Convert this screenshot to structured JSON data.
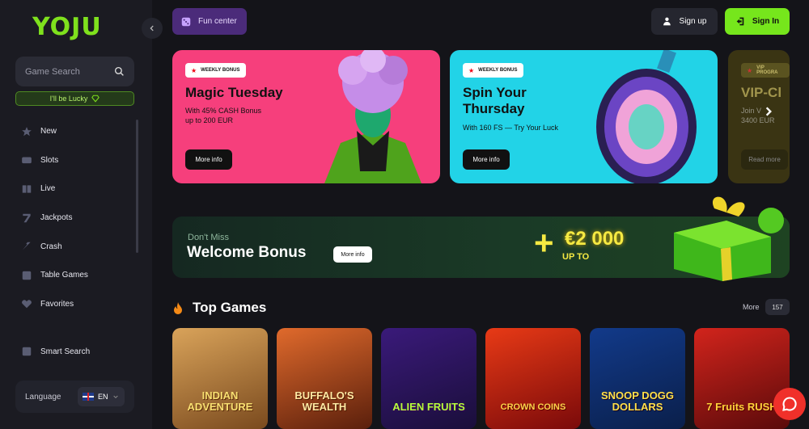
{
  "logo": {
    "text": "YOJU"
  },
  "sidebar": {
    "search_placeholder": "Game Search",
    "lucky_label": "I'll be Lucky",
    "items": [
      {
        "label": "New",
        "icon": "star-icon"
      },
      {
        "label": "Slots",
        "icon": "slot-machine-icon"
      },
      {
        "label": "Live",
        "icon": "cards-icon"
      },
      {
        "label": "Jackpots",
        "icon": "seven-icon"
      },
      {
        "label": "Crash",
        "icon": "rocket-icon"
      },
      {
        "label": "Table Games",
        "icon": "dice-icon"
      },
      {
        "label": "Favorites",
        "icon": "heart-icon"
      }
    ],
    "smart_search": "Smart Search",
    "language_label": "Language",
    "language_value": "EN"
  },
  "header": {
    "fun_center": "Fun center",
    "sign_up": "Sign up",
    "sign_in": "Sign In"
  },
  "promos": [
    {
      "badge": "WEEKLY BONUS",
      "title": "Magic Tuesday",
      "desc_line1": "With 45% CASH Bonus",
      "desc_line2": "up to 200 EUR",
      "button": "More info"
    },
    {
      "badge": "WEEKLY BONUS",
      "title_line1": "Spin Your",
      "title_line2": "Thursday",
      "desc": "With 160 FS — Try Your Luck",
      "button": "More info"
    },
    {
      "badge": "VIP PROGRA",
      "title": "VIP-Cl",
      "desc_line1": "Join V",
      "desc_line2": "3400 EUR",
      "button": "Read more"
    }
  ],
  "welcome": {
    "pre": "Don't Miss",
    "title": "Welcome Bonus",
    "button": "More info",
    "plus": "+",
    "amount": "€2 000",
    "upto": "UP TO"
  },
  "top_games": {
    "title": "Top Games",
    "more": "More",
    "count": "157",
    "games": [
      "INDIAN ADVENTURE",
      "BUFFALO'S WEALTH",
      "ALIEN FRUITS",
      "CROWN COINS",
      "SNOOP DOGG DOLLARS",
      "7 Fruits RUSH"
    ]
  },
  "colors": {
    "brand_green": "#76e61c",
    "card_pink": "#f63f7c",
    "card_cyan": "#22d3e7",
    "fun_purple": "#4b2b7a"
  }
}
